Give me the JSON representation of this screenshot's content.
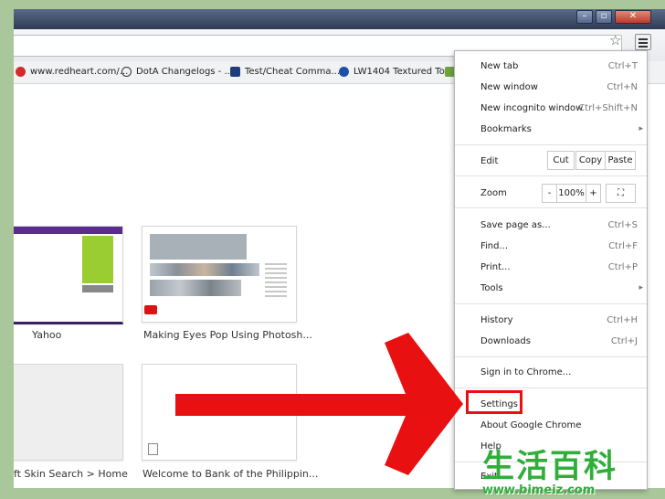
{
  "bookmarks": [
    {
      "label": "www.redheart.com/...",
      "icon": "redheart-icon",
      "color": "#d12b2b"
    },
    {
      "label": "DotA Changelogs - ...",
      "icon": "dota-icon",
      "color": "#333333"
    },
    {
      "label": "Test/Cheat Comma...",
      "icon": "test-icon",
      "color": "#1e3d7a"
    },
    {
      "label": "LW1404 Textured Top",
      "icon": "lw-icon",
      "color": "#1e4fa8"
    }
  ],
  "tiles": [
    {
      "label": "Yahoo"
    },
    {
      "label": "Making Eyes Pop Using Photosh..."
    },
    {
      "label": "ft Skin Search > Home"
    },
    {
      "label": "Welcome to Bank of the Philippin..."
    }
  ],
  "menu": {
    "new_tab": "New tab",
    "new_tab_sc": "Ctrl+T",
    "new_window": "New window",
    "new_window_sc": "Ctrl+N",
    "incognito": "New incognito window",
    "incognito_sc": "Ctrl+Shift+N",
    "bookmarks": "Bookmarks",
    "edit": "Edit",
    "cut": "Cut",
    "copy": "Copy",
    "paste": "Paste",
    "zoom": "Zoom",
    "zoom_minus": "-",
    "zoom_value": "100%",
    "zoom_plus": "+",
    "save_page": "Save page as...",
    "save_page_sc": "Ctrl+S",
    "find": "Find...",
    "find_sc": "Ctrl+F",
    "print": "Print...",
    "print_sc": "Ctrl+P",
    "tools": "Tools",
    "history": "History",
    "history_sc": "Ctrl+H",
    "downloads": "Downloads",
    "downloads_sc": "Ctrl+J",
    "sign_in": "Sign in to Chrome...",
    "settings": "Settings",
    "about": "About Google Chrome",
    "help": "Help",
    "exit": "Exit"
  },
  "watermark": {
    "text": "生活百科",
    "url": "www.bimeiz.com"
  },
  "colors": {
    "arrow": "#e81010",
    "watermark": "#2fae3a",
    "background": "#a9c79a"
  }
}
